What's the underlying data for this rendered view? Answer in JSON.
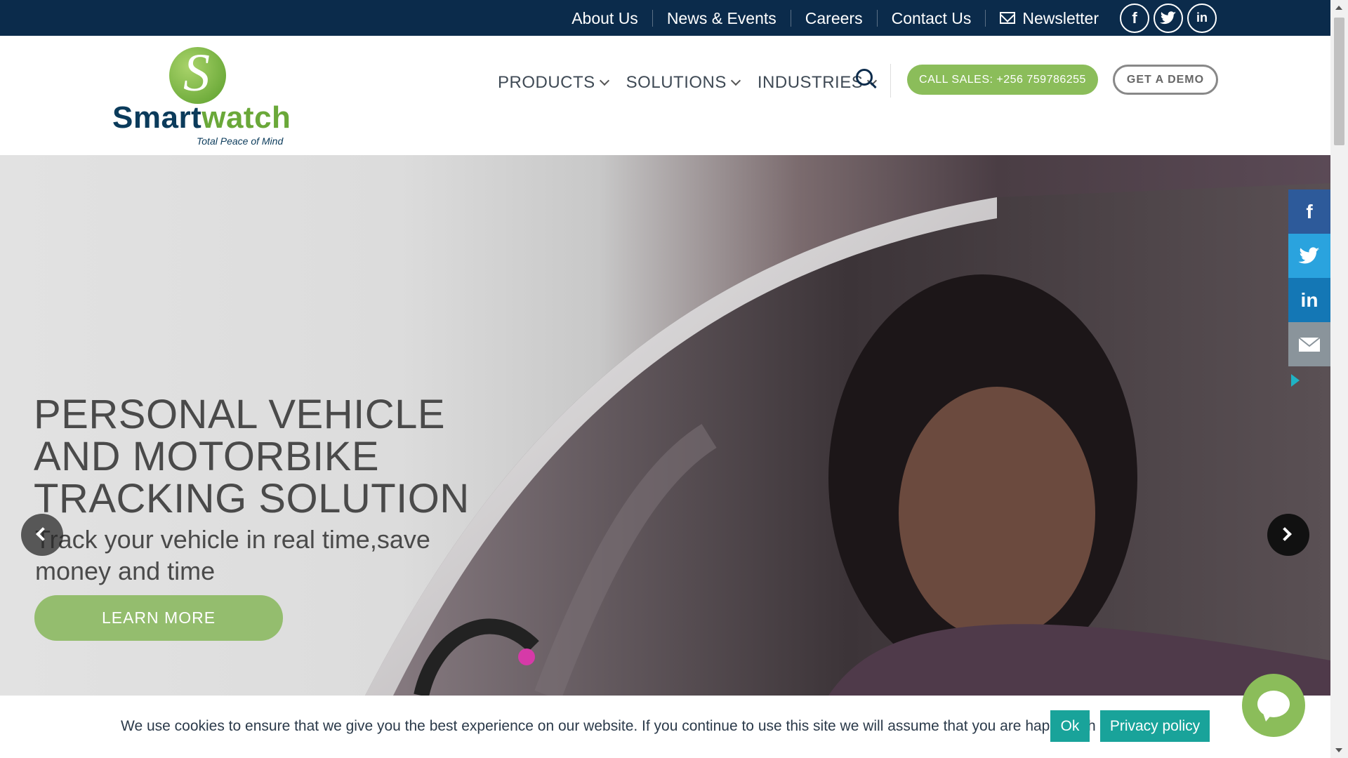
{
  "topbar": {
    "links": [
      "About Us",
      "News & Events",
      "Careers",
      "Contact Us"
    ],
    "newsletter_label": "Newsletter",
    "social": [
      "f",
      "t",
      "in"
    ],
    "bg_color": "#0b2b4b"
  },
  "header": {
    "logo_text_a": "Smart",
    "logo_text_b": "watch",
    "logo_tagline": "Total Peace of Mind",
    "nav": [
      "PRODUCTS",
      "SOLUTIONS",
      "INDUSTRIES"
    ],
    "call_sales": "CALL SALES: +256 759786255",
    "get_demo": "GET A DEMO",
    "accent_color": "#8bbd5a"
  },
  "hero": {
    "title_lines": [
      "PERSONAL VEHICLE",
      "AND MOTORBIKE",
      "TRACKING SOLUTION"
    ],
    "subtitle": "Track your vehicle in real time,save money and time",
    "cta": "LEARN MORE"
  },
  "share": [
    "f",
    "t",
    "in",
    "mail"
  ],
  "cookie": {
    "text": "We use cookies to ensure that we give you the best experience on our website. If you continue to use this site we will assume that you are happy with it.",
    "ok": "Ok",
    "privacy": "Privacy policy",
    "button_color": "#19a39a"
  }
}
